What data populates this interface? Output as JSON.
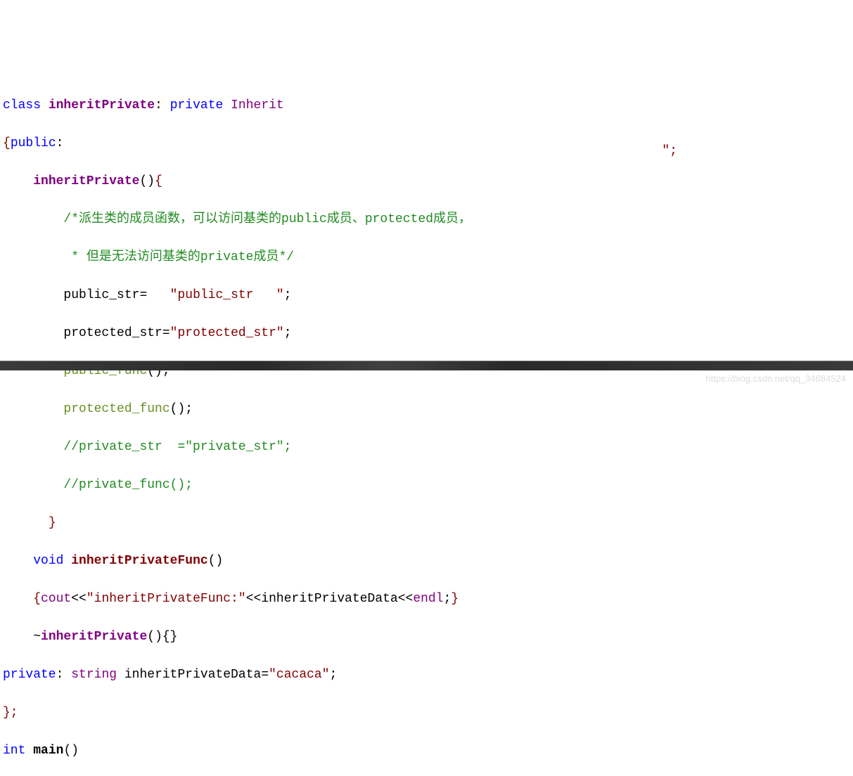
{
  "code": {
    "line1": {
      "kw_class": "class",
      "classname": "inheritPrivate",
      "colon": ":",
      "kw_private": "private",
      "basename": "Inherit"
    },
    "line2": {
      "open_brace": "{",
      "kw_public": "public",
      "colon": ":"
    },
    "line3": {
      "ctor": "inheritPrivate",
      "parens": "()",
      "open": "{"
    },
    "line4": {
      "comment": "/*派生类的成员函数，可以访问基类的public成员、protected成员，"
    },
    "line5": {
      "comment": " * 但是无法访问基类的private成员*/"
    },
    "line6": {
      "var": "public_str",
      "eq": "=",
      "str": "\"public_str   \"",
      "semi": ";"
    },
    "line7": {
      "var": "protected_str",
      "eq": "=",
      "str": "\"protected_str\"",
      "semi": ";"
    },
    "line8": {
      "fn": "public_func",
      "parens": "();"
    },
    "line9": {
      "fn": "protected_func",
      "parens": "();"
    },
    "line10": {
      "comment": "//private_str  =\"private_str\";"
    },
    "line11": {
      "comment": "//private_func();"
    },
    "line12": {
      "close": "}"
    },
    "line13": {
      "kw_void": "void",
      "fn": "inheritPrivateFunc",
      "parens": "()"
    },
    "line14": {
      "open": "{",
      "cout": "cout",
      "op1": "<<",
      "str": "\"inheritPrivateFunc:\"",
      "op2": "<<",
      "data": "inheritPrivateData",
      "op3": "<<",
      "endl": "endl",
      "semi": ";",
      "close": "}"
    },
    "line15": {
      "tilde": "~",
      "dtor": "inheritPrivate",
      "rest": "(){}"
    },
    "line16": {
      "kw_private": "private",
      "colon": ":",
      "type": "string",
      "var": "inheritPrivateData",
      "eq": "=",
      "str": "\"cacaca\"",
      "semi": ";"
    },
    "line17": {
      "close": "};"
    },
    "line18": {
      "kw_int": "int",
      "main": "main",
      "parens": "()"
    }
  },
  "stray": "\";",
  "watermark": "https://blog.csdn.net/qq_34684524"
}
